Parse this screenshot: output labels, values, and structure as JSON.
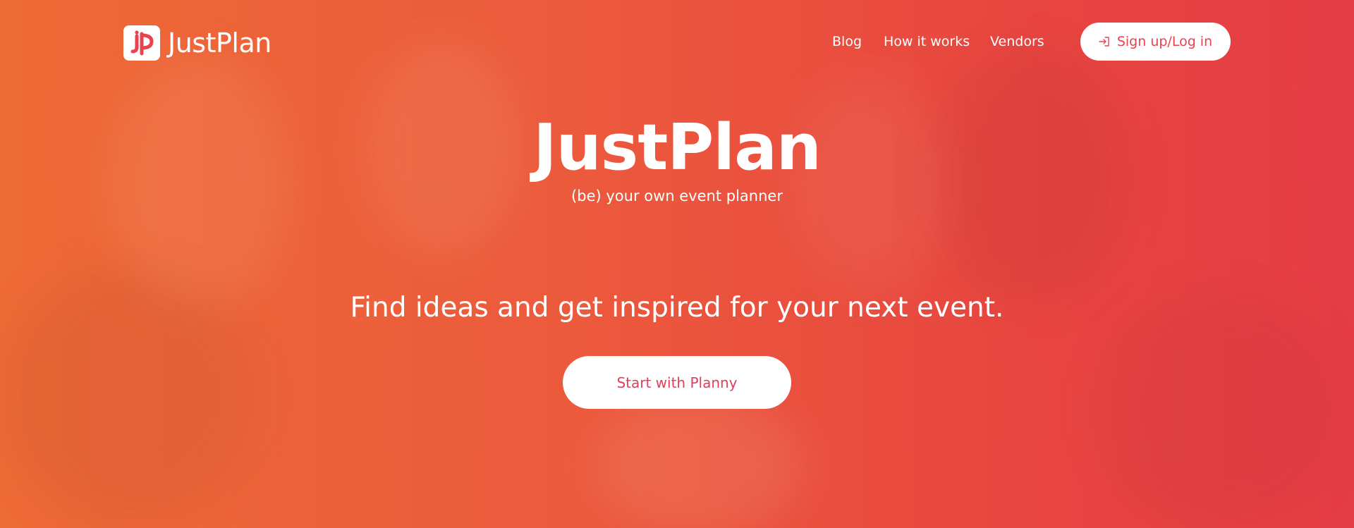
{
  "header": {
    "brand_name": "JustPlan",
    "nav": [
      {
        "label": "Blog"
      },
      {
        "label": "How it works"
      },
      {
        "label": "Vendors"
      }
    ],
    "login_label": "Sign up/Log in",
    "login_icon": "sign-in-icon"
  },
  "hero": {
    "title": "JustPlan",
    "subtitle": "(be) your own event planner",
    "tagline": "Find ideas and get inspired for your next event.",
    "cta_label": "Start with Planny"
  },
  "colors": {
    "gradient_start": "#ee6a36",
    "gradient_end": "#e53d44",
    "accent": "#e8434e",
    "button_bg": "#ffffff"
  }
}
